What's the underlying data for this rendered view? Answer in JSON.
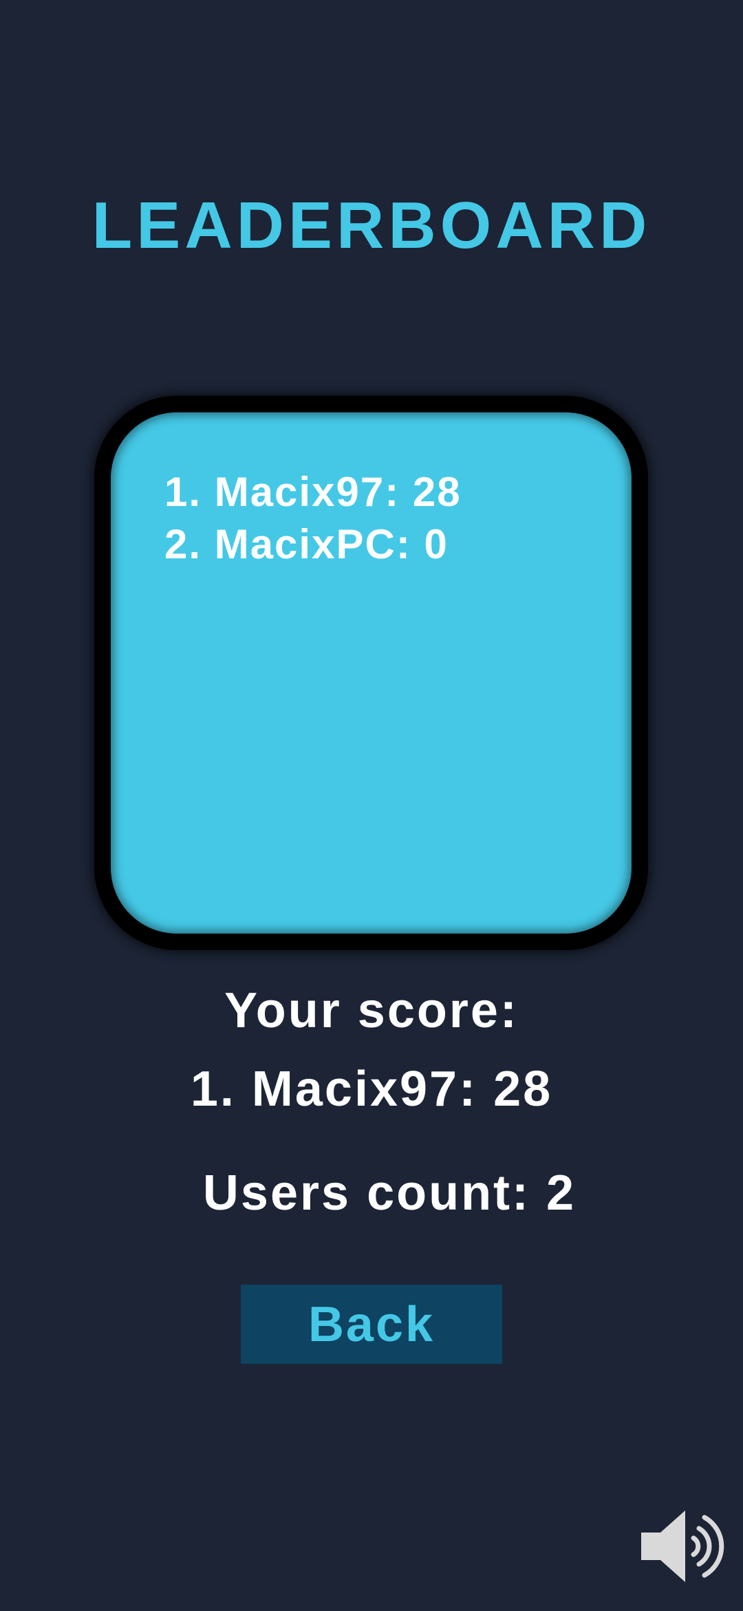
{
  "title": "LEADERBOARD",
  "leaderboard": {
    "entries": [
      "1. Macix97: 28",
      "2. MacixPC: 0"
    ]
  },
  "your_score": {
    "label": "Your score:",
    "value": "1. Macix97: 28"
  },
  "users_count": {
    "label": "Users count:",
    "value": "2"
  },
  "back_button": {
    "label": "Back"
  },
  "sound_toggle": {
    "icon": "speaker-sound-on-icon"
  },
  "colors": {
    "background": "#1c2435",
    "accent": "#44c8e6",
    "button_background": "#0e4361",
    "text": "#ffffff"
  }
}
